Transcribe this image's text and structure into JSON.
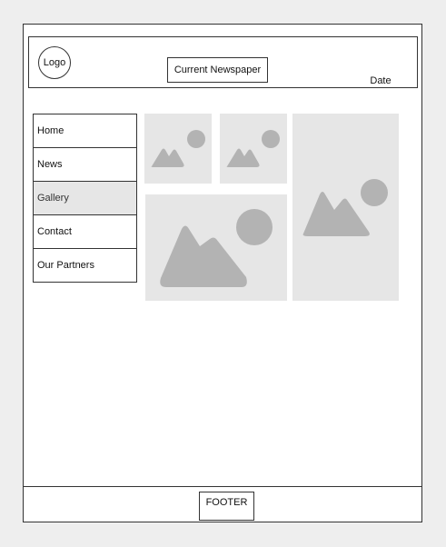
{
  "header": {
    "logo_label": "Logo",
    "title": "Current Newspaper",
    "date_label": "Date"
  },
  "nav": {
    "items": [
      {
        "label": "Home",
        "active": false
      },
      {
        "label": "News",
        "active": false
      },
      {
        "label": "Gallery",
        "active": true
      },
      {
        "label": "Contact",
        "active": false
      },
      {
        "label": "Our Partners",
        "active": false
      }
    ]
  },
  "gallery": {
    "images": [
      {
        "icon": "image-placeholder-icon"
      },
      {
        "icon": "image-placeholder-icon"
      },
      {
        "icon": "image-placeholder-icon"
      },
      {
        "icon": "image-placeholder-icon"
      }
    ]
  },
  "footer": {
    "label": "FOOTER"
  },
  "colors": {
    "background": "#eeeeee",
    "page": "#ffffff",
    "border": "#333333",
    "placeholder_bg": "#e6e6e6",
    "placeholder_shape": "#b3b3b3",
    "active_nav": "#e6e6e6"
  }
}
